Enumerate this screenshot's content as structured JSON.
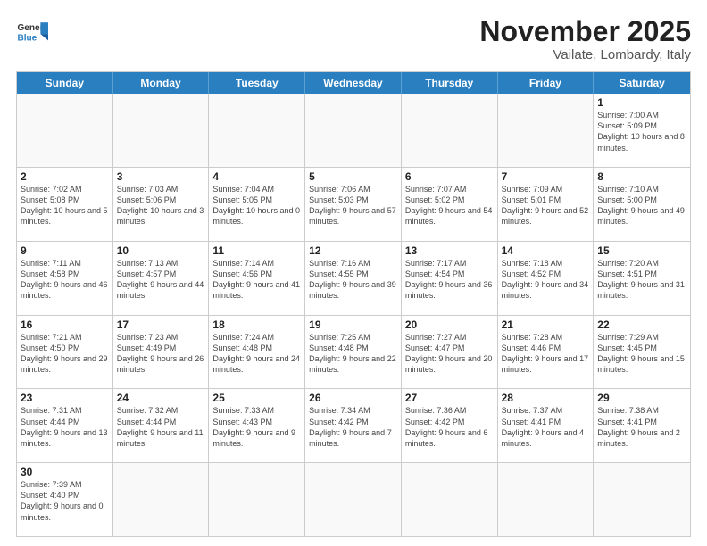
{
  "header": {
    "logo_general": "General",
    "logo_blue": "Blue",
    "title": "November 2025",
    "subtitle": "Vailate, Lombardy, Italy"
  },
  "weekdays": [
    "Sunday",
    "Monday",
    "Tuesday",
    "Wednesday",
    "Thursday",
    "Friday",
    "Saturday"
  ],
  "weeks": [
    [
      {
        "day": "",
        "info": ""
      },
      {
        "day": "",
        "info": ""
      },
      {
        "day": "",
        "info": ""
      },
      {
        "day": "",
        "info": ""
      },
      {
        "day": "",
        "info": ""
      },
      {
        "day": "",
        "info": ""
      },
      {
        "day": "1",
        "info": "Sunrise: 7:00 AM\nSunset: 5:09 PM\nDaylight: 10 hours\nand 8 minutes."
      }
    ],
    [
      {
        "day": "2",
        "info": "Sunrise: 7:02 AM\nSunset: 5:08 PM\nDaylight: 10 hours\nand 5 minutes."
      },
      {
        "day": "3",
        "info": "Sunrise: 7:03 AM\nSunset: 5:06 PM\nDaylight: 10 hours\nand 3 minutes."
      },
      {
        "day": "4",
        "info": "Sunrise: 7:04 AM\nSunset: 5:05 PM\nDaylight: 10 hours\nand 0 minutes."
      },
      {
        "day": "5",
        "info": "Sunrise: 7:06 AM\nSunset: 5:03 PM\nDaylight: 9 hours\nand 57 minutes."
      },
      {
        "day": "6",
        "info": "Sunrise: 7:07 AM\nSunset: 5:02 PM\nDaylight: 9 hours\nand 54 minutes."
      },
      {
        "day": "7",
        "info": "Sunrise: 7:09 AM\nSunset: 5:01 PM\nDaylight: 9 hours\nand 52 minutes."
      },
      {
        "day": "8",
        "info": "Sunrise: 7:10 AM\nSunset: 5:00 PM\nDaylight: 9 hours\nand 49 minutes."
      }
    ],
    [
      {
        "day": "9",
        "info": "Sunrise: 7:11 AM\nSunset: 4:58 PM\nDaylight: 9 hours\nand 46 minutes."
      },
      {
        "day": "10",
        "info": "Sunrise: 7:13 AM\nSunset: 4:57 PM\nDaylight: 9 hours\nand 44 minutes."
      },
      {
        "day": "11",
        "info": "Sunrise: 7:14 AM\nSunset: 4:56 PM\nDaylight: 9 hours\nand 41 minutes."
      },
      {
        "day": "12",
        "info": "Sunrise: 7:16 AM\nSunset: 4:55 PM\nDaylight: 9 hours\nand 39 minutes."
      },
      {
        "day": "13",
        "info": "Sunrise: 7:17 AM\nSunset: 4:54 PM\nDaylight: 9 hours\nand 36 minutes."
      },
      {
        "day": "14",
        "info": "Sunrise: 7:18 AM\nSunset: 4:52 PM\nDaylight: 9 hours\nand 34 minutes."
      },
      {
        "day": "15",
        "info": "Sunrise: 7:20 AM\nSunset: 4:51 PM\nDaylight: 9 hours\nand 31 minutes."
      }
    ],
    [
      {
        "day": "16",
        "info": "Sunrise: 7:21 AM\nSunset: 4:50 PM\nDaylight: 9 hours\nand 29 minutes."
      },
      {
        "day": "17",
        "info": "Sunrise: 7:23 AM\nSunset: 4:49 PM\nDaylight: 9 hours\nand 26 minutes."
      },
      {
        "day": "18",
        "info": "Sunrise: 7:24 AM\nSunset: 4:48 PM\nDaylight: 9 hours\nand 24 minutes."
      },
      {
        "day": "19",
        "info": "Sunrise: 7:25 AM\nSunset: 4:48 PM\nDaylight: 9 hours\nand 22 minutes."
      },
      {
        "day": "20",
        "info": "Sunrise: 7:27 AM\nSunset: 4:47 PM\nDaylight: 9 hours\nand 20 minutes."
      },
      {
        "day": "21",
        "info": "Sunrise: 7:28 AM\nSunset: 4:46 PM\nDaylight: 9 hours\nand 17 minutes."
      },
      {
        "day": "22",
        "info": "Sunrise: 7:29 AM\nSunset: 4:45 PM\nDaylight: 9 hours\nand 15 minutes."
      }
    ],
    [
      {
        "day": "23",
        "info": "Sunrise: 7:31 AM\nSunset: 4:44 PM\nDaylight: 9 hours\nand 13 minutes."
      },
      {
        "day": "24",
        "info": "Sunrise: 7:32 AM\nSunset: 4:44 PM\nDaylight: 9 hours\nand 11 minutes."
      },
      {
        "day": "25",
        "info": "Sunrise: 7:33 AM\nSunset: 4:43 PM\nDaylight: 9 hours\nand 9 minutes."
      },
      {
        "day": "26",
        "info": "Sunrise: 7:34 AM\nSunset: 4:42 PM\nDaylight: 9 hours\nand 7 minutes."
      },
      {
        "day": "27",
        "info": "Sunrise: 7:36 AM\nSunset: 4:42 PM\nDaylight: 9 hours\nand 6 minutes."
      },
      {
        "day": "28",
        "info": "Sunrise: 7:37 AM\nSunset: 4:41 PM\nDaylight: 9 hours\nand 4 minutes."
      },
      {
        "day": "29",
        "info": "Sunrise: 7:38 AM\nSunset: 4:41 PM\nDaylight: 9 hours\nand 2 minutes."
      }
    ],
    [
      {
        "day": "30",
        "info": "Sunrise: 7:39 AM\nSunset: 4:40 PM\nDaylight: 9 hours\nand 0 minutes."
      },
      {
        "day": "",
        "info": ""
      },
      {
        "day": "",
        "info": ""
      },
      {
        "day": "",
        "info": ""
      },
      {
        "day": "",
        "info": ""
      },
      {
        "day": "",
        "info": ""
      },
      {
        "day": "",
        "info": ""
      }
    ]
  ]
}
